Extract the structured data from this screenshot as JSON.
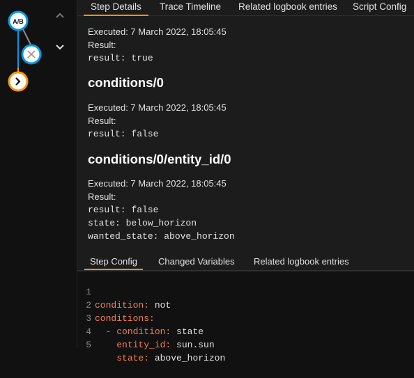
{
  "tabs": [
    "Step Details",
    "Trace Timeline",
    "Related logbook entries",
    "Script Config"
  ],
  "details": [
    {
      "executed": "Executed: 7 March 2022, 18:05:45",
      "result_label": "Result:",
      "lines": [
        "result: true"
      ]
    },
    {
      "heading": "conditions/0",
      "executed": "Executed: 7 March 2022, 18:05:45",
      "result_label": "Result:",
      "lines": [
        "result: false"
      ]
    },
    {
      "heading": "conditions/0/entity_id/0",
      "executed": "Executed: 7 March 2022, 18:05:45",
      "result_label": "Result:",
      "lines": [
        "result: false",
        "state: below_horizon",
        "wanted_state: above_horizon"
      ]
    }
  ],
  "config_tabs": [
    "Step Config",
    "Changed Variables",
    "Related logbook entries"
  ],
  "code": {
    "line_numbers": [
      "1",
      "2",
      "3",
      "4",
      "5"
    ],
    "lines": [
      {
        "indent": "",
        "key": "condition:",
        "value": " not"
      },
      {
        "indent": "",
        "key": "conditions:",
        "value": ""
      },
      {
        "indent": "  - ",
        "key": "condition:",
        "value": " state"
      },
      {
        "indent": "    ",
        "key": "entity_id:",
        "value": " sun.sun"
      },
      {
        "indent": "    ",
        "key": "state:",
        "value": " above_horizon"
      }
    ]
  },
  "graph": {
    "ab_node_label": "A/B",
    "colors": {
      "ab_node": "#039be5",
      "x_node": "#039be5",
      "action_node": "#ff9800",
      "line_blue": "#039be5",
      "line_orange": "#ff9800",
      "line_gray": "#8a8a8a"
    },
    "icons": [
      "ab-condition-icon",
      "close-icon",
      "chevron-right-icon",
      "chevron-up-icon",
      "chevron-down-icon"
    ]
  },
  "theme": {
    "accent": "#ff9800",
    "key_color": "#f47c5a"
  }
}
